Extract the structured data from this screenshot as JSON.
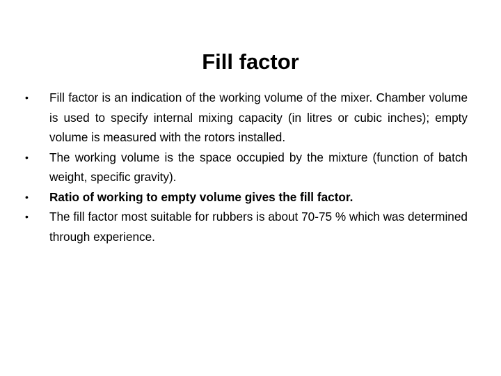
{
  "slide": {
    "title": "Fill factor",
    "bullets": [
      {
        "text": "Fill factor is an indication of the working volume of the mixer. Chamber volume is used to specify internal mixing capacity (in litres or cubic inches); empty volume is measured with the rotors installed.",
        "bold": false
      },
      {
        "text": "The working volume is the space occupied by the mixture (function of batch weight, specific gravity).",
        "bold": false
      },
      {
        "text": "Ratio of working to empty volume gives the fill factor.",
        "bold": true
      },
      {
        "text": "The fill factor most suitable for rubbers is about 70-75 % which was determined through experience.",
        "bold": false
      }
    ],
    "bullet_glyph": "•"
  }
}
